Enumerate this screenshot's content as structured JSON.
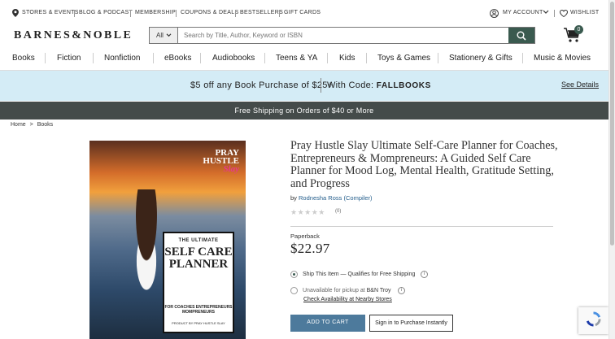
{
  "util_links": [
    "Stores & Events",
    "Blog & Podcast",
    "Membership",
    "Coupons & Deals",
    "Bestsellers",
    "Gift Cards"
  ],
  "account": {
    "label": "My Account",
    "wishlist": "Wishlist"
  },
  "logo": {
    "text": "BARNES&NOBLE"
  },
  "search": {
    "category": "All",
    "placeholder": "Search by Title, Author, Keyword or ISBN"
  },
  "cart": {
    "count": "0"
  },
  "nav": [
    "Books",
    "Fiction",
    "Nonfiction",
    "eBooks",
    "Audiobooks",
    "Teens & YA",
    "Kids",
    "Toys & Games",
    "Stationery & Gifts",
    "Music & Movies"
  ],
  "promo": {
    "text": "$5 off any Book Purchase of $25+",
    "code_label": "With Code:",
    "code": "FALLBOOKS",
    "link": "See Details"
  },
  "shipping_bar": "Free Shipping on Orders of $40 or More",
  "breadcrumb": {
    "home": "Home",
    "sep": ">",
    "current": "Books"
  },
  "cover": {
    "title_line1": "PRAY",
    "title_line2": "HUSTLE",
    "title_line3": "Slay",
    "box_kicker": "THE ULTIMATE",
    "box_main": "SELF CARE PLANNER",
    "box_for": "FOR COACHES ENTREPRENEURS MOMPRENEURS",
    "box_product": "PRODUCT BY PRAY HUSTLE SLAY"
  },
  "product": {
    "title": "Pray Hustle Slay Ultimate Self-Care Planner for Coaches, Entrepreneurs & Mompreneurs: A Guided Self Care Planner for Mood Log, Mental Health, Gratitude Setting, and Progress",
    "by": "by",
    "author": "Rodnesha Ross",
    "role": "(Compiler)",
    "rating_count": "(0)",
    "format": "Paperback",
    "price": "$22.97"
  },
  "fulfillment": {
    "ship_label": "Ship This Item — ",
    "ship_note": "Qualifies for Free Shipping",
    "pickup_label": "Unavailable for pickup at ",
    "pickup_store": "B&N Troy",
    "availability_link": "Check Availability at Nearby Stores"
  },
  "buttons": {
    "add_to_cart": "ADD TO CART",
    "sign_in": "Sign in to Purchase Instantly"
  }
}
